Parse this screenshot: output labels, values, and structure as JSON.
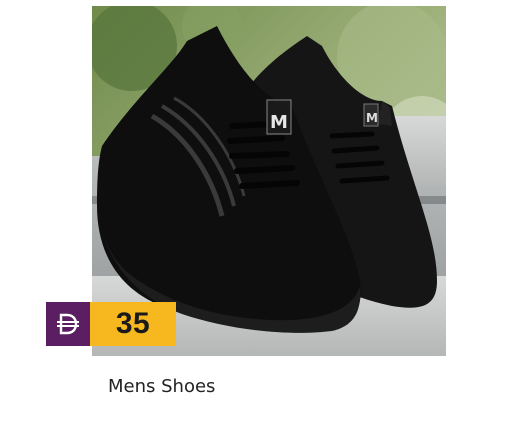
{
  "product": {
    "name": "Mens Shoes",
    "image_icon": "product-photo-black-knit-sneakers",
    "price": {
      "currency_icon": "dirham-currency-icon",
      "amount": "35"
    }
  },
  "colors": {
    "currency_bg": "#5b1e63",
    "amount_bg": "#f7b81f",
    "shoe": "#111111"
  }
}
